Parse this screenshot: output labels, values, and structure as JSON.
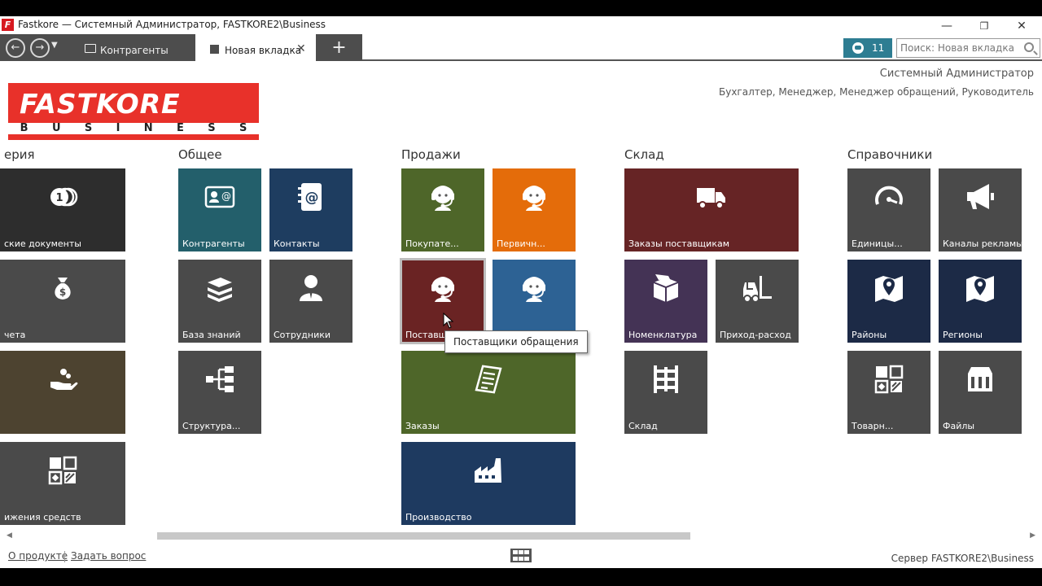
{
  "window": {
    "title": "Fastkore — Системный Администратор, FASTKORE2\\Business",
    "logo_letter": "F",
    "minimize": "—",
    "restore": "❐",
    "close": "✕"
  },
  "tabbar": {
    "back": "←",
    "forward": "→",
    "history_dropdown": "▼",
    "tabs": [
      {
        "label": "Контрагенты",
        "icon": "contact-card-icon",
        "active": false
      },
      {
        "label": "Новая вкладка",
        "icon": "tab-square-icon",
        "active": true,
        "close": "✕"
      }
    ],
    "add_tab": "+",
    "notifications_count": "11",
    "search_placeholder": "Поиск: Новая вкладка"
  },
  "header": {
    "brand_main": "FASTKORE",
    "brand_sub": [
      "B",
      "U",
      "S",
      "I",
      "N",
      "E",
      "S",
      "S"
    ],
    "user_name": "Системный Администратор",
    "user_roles": "Бухгалтер, Менеджер, Менеджер обращений, Руководитель"
  },
  "groups": [
    {
      "title": "ерия",
      "tiles": [
        {
          "label": "ские документы",
          "icon": "coins-icon",
          "color": "#2d2d2d"
        },
        {
          "label": "чета",
          "icon": "money-bag-icon",
          "color": "#4a4a4a"
        },
        {
          "label": "",
          "icon": "hand-coin-icon",
          "color": "#4d4330"
        },
        {
          "label": "ижения средств",
          "icon": "widgets-icon",
          "color": "#4a4a4a"
        }
      ]
    },
    {
      "title": "Общее",
      "tiles": [
        {
          "label": "Контрагенты",
          "icon": "contact-card-icon",
          "color": "#235f6b"
        },
        {
          "label": "Контакты",
          "icon": "address-book-icon",
          "color": "#1e3d60"
        },
        {
          "label": "База знаний",
          "icon": "books-icon",
          "color": "#4a4a4a"
        },
        {
          "label": "Сотрудники",
          "icon": "person-icon",
          "color": "#4a4a4a"
        },
        {
          "label": "Структура...",
          "icon": "org-structure-icon",
          "color": "#4a4a4a"
        }
      ]
    },
    {
      "title": "Продажи",
      "tiles": [
        {
          "label": "Покупате...",
          "icon": "headset-operator-icon",
          "color": "#4e6629"
        },
        {
          "label": "Первичн...",
          "icon": "headset-operator-icon",
          "color": "#e46c0a"
        },
        {
          "label": "Поставщ...",
          "icon": "headset-operator-icon",
          "color": "#6a2323"
        },
        {
          "label": "",
          "icon": "headset-operator-icon",
          "color": "#2d6294"
        },
        {
          "label": "Заказы",
          "icon": "receipt-icon",
          "color": "#4e6629"
        },
        {
          "label": "Производство",
          "icon": "factory-icon",
          "color": "#1e3a60"
        }
      ]
    },
    {
      "title": "Склад",
      "tiles": [
        {
          "label": "Заказы поставщикам",
          "icon": "truck-icon",
          "color": "#662425"
        },
        {
          "label": "Номенклатура",
          "icon": "box-icon",
          "color": "#443355"
        },
        {
          "label": "Приход-расход",
          "icon": "forklift-icon",
          "color": "#4a4a4a"
        },
        {
          "label": "Склад",
          "icon": "shelving-icon",
          "color": "#4a4a4a"
        }
      ]
    },
    {
      "title": "Справочники",
      "tiles": [
        {
          "label": "Единицы...",
          "icon": "gauge-icon",
          "color": "#4a4a4a"
        },
        {
          "label": "Каналы рекламы",
          "icon": "megaphone-icon",
          "color": "#4a4a4a"
        },
        {
          "label": "Районы",
          "icon": "map-pin-icon",
          "color": "#1c2a46"
        },
        {
          "label": "Регионы",
          "icon": "map-pin-icon",
          "color": "#1c2a46"
        },
        {
          "label": "Товарн...",
          "icon": "widgets-icon",
          "color": "#4a4a4a"
        },
        {
          "label": "Файлы",
          "icon": "file-cabinet-icon",
          "color": "#4a4a4a"
        }
      ]
    }
  ],
  "tooltip": "Поставщики обращения",
  "scroll": {
    "left": "◀",
    "right": "▶"
  },
  "footer": {
    "about": "О продукте",
    "ask": "Задать вопрос",
    "server": "Сервер FASTKORE2\\Business"
  }
}
